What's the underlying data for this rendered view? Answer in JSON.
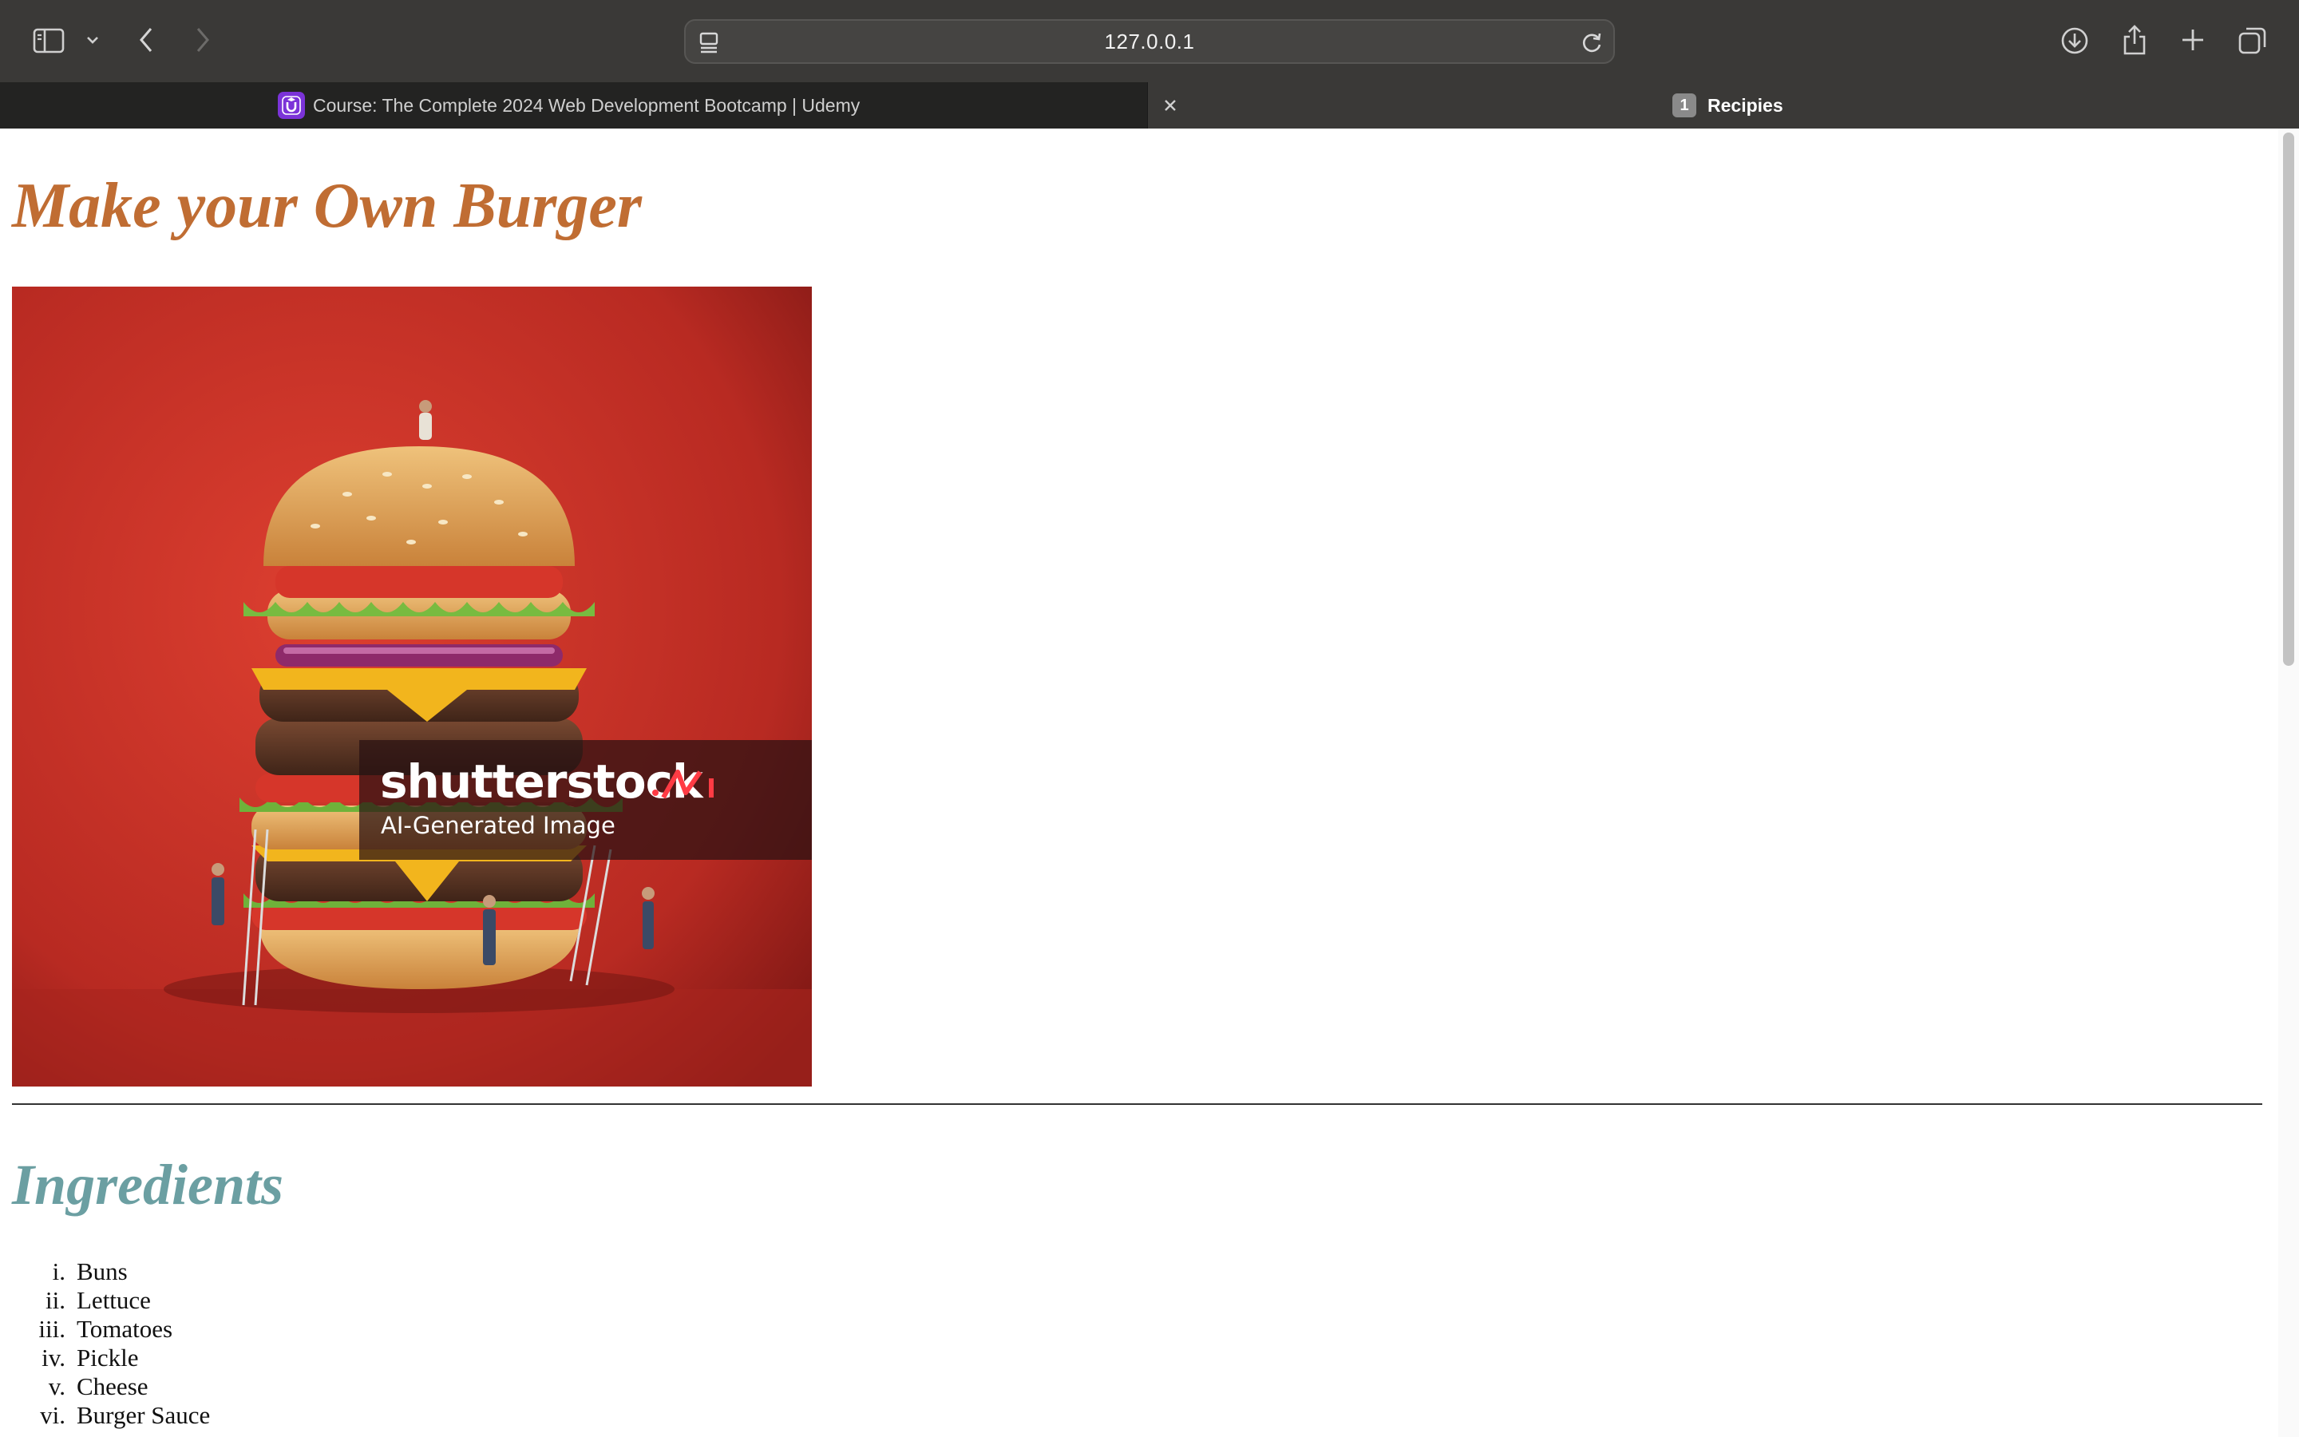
{
  "browser": {
    "address": "127.0.0.1",
    "tabs": [
      {
        "title": "Course: The Complete 2024 Web Development Bootcamp | Udemy",
        "favicon": "udemy-icon",
        "active": true
      },
      {
        "title": "Recipies",
        "group_count": "1",
        "active": false
      }
    ],
    "icons": [
      "sidebar-icon",
      "chevron-down-icon",
      "back-icon",
      "forward-icon",
      "page-menu-icon",
      "reload-icon",
      "download-icon",
      "share-icon",
      "plus-icon",
      "tabs-overview-icon",
      "close-icon"
    ]
  },
  "page": {
    "title": "Make your Own Burger",
    "hero_image": {
      "watermark_brand": "shutterstock",
      "watermark_caption": "AI-Generated Image"
    },
    "section_title": "Ingredients",
    "ingredients": [
      {
        "num": "i.",
        "text": "Buns"
      },
      {
        "num": "ii.",
        "text": "Lettuce"
      },
      {
        "num": "iii.",
        "text": "Tomatoes"
      },
      {
        "num": "iv.",
        "text": "Pickle"
      },
      {
        "num": "v.",
        "text": "Cheese"
      },
      {
        "num": "vi.",
        "text": "Burger Sauce"
      }
    ]
  },
  "colors": {
    "title": "#c06d33",
    "section_title": "#6b9fa2",
    "chrome": "#3a3937",
    "active_tab": "#232322"
  }
}
